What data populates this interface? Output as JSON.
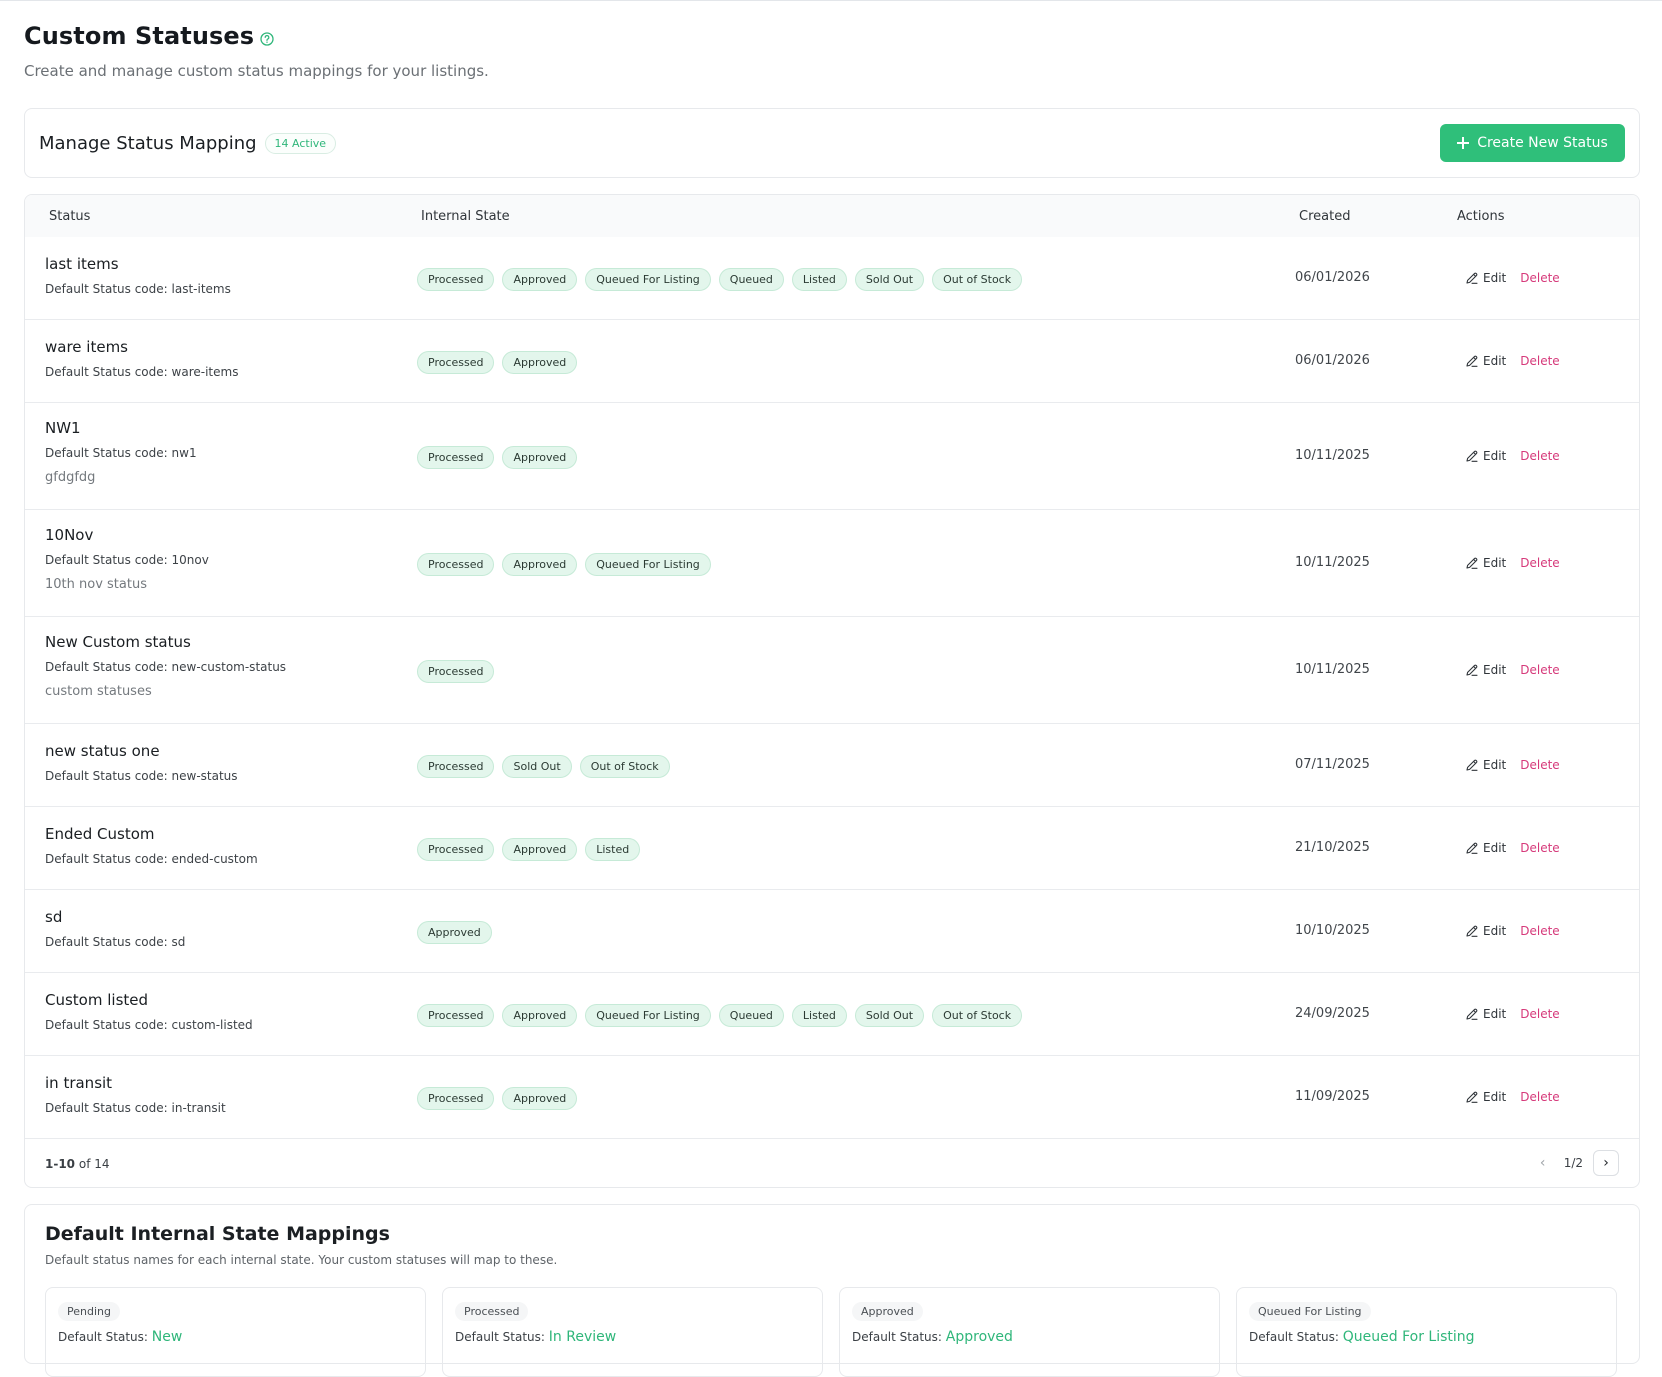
{
  "header": {
    "title": "Custom Statuses",
    "subtitle": "Create and manage custom status mappings for your listings."
  },
  "manage": {
    "title": "Manage Status Mapping",
    "active_badge": "14 Active",
    "create_button": "Create New Status"
  },
  "table": {
    "columns": [
      "Status",
      "Internal State",
      "Created",
      "Actions"
    ],
    "code_prefix": "Default Status code:",
    "edit_label": "Edit",
    "delete_label": "Delete",
    "rows": [
      {
        "name": "last items",
        "code": "last-items",
        "description": "",
        "states": [
          "Processed",
          "Approved",
          "Queued For Listing",
          "Queued",
          "Listed",
          "Sold Out",
          "Out of Stock"
        ],
        "created": "06/01/2026"
      },
      {
        "name": "ware items",
        "code": "ware-items",
        "description": "",
        "states": [
          "Processed",
          "Approved"
        ],
        "created": "06/01/2026"
      },
      {
        "name": "NW1",
        "code": "nw1",
        "description": "gfdgfdg",
        "states": [
          "Processed",
          "Approved"
        ],
        "created": "10/11/2025"
      },
      {
        "name": "10Nov",
        "code": "10nov",
        "description": "10th nov status",
        "states": [
          "Processed",
          "Approved",
          "Queued For Listing"
        ],
        "created": "10/11/2025"
      },
      {
        "name": "New Custom status",
        "code": "new-custom-status",
        "description": "custom statuses",
        "states": [
          "Processed"
        ],
        "created": "10/11/2025"
      },
      {
        "name": "new status one",
        "code": "new-status",
        "description": "",
        "states": [
          "Processed",
          "Sold Out",
          "Out of Stock"
        ],
        "created": "07/11/2025"
      },
      {
        "name": "Ended Custom",
        "code": "ended-custom",
        "description": "",
        "states": [
          "Processed",
          "Approved",
          "Listed"
        ],
        "created": "21/10/2025"
      },
      {
        "name": "sd",
        "code": "sd",
        "description": "",
        "states": [
          "Approved"
        ],
        "created": "10/10/2025"
      },
      {
        "name": "Custom listed",
        "code": "custom-listed",
        "description": "",
        "states": [
          "Processed",
          "Approved",
          "Queued For Listing",
          "Queued",
          "Listed",
          "Sold Out",
          "Out of Stock"
        ],
        "created": "24/09/2025"
      },
      {
        "name": "in transit",
        "code": "in-transit",
        "description": "",
        "states": [
          "Processed",
          "Approved"
        ],
        "created": "11/09/2025"
      }
    ]
  },
  "pagination": {
    "range": "1-10",
    "of_text": "of 14",
    "page": "1/2"
  },
  "defaults": {
    "title": "Default Internal State Mappings",
    "subtitle": "Default status names for each internal state. Your custom statuses will map to these.",
    "default_prefix": "Default Status:",
    "items": [
      {
        "state": "Pending",
        "value": "New"
      },
      {
        "state": "Processed",
        "value": "In Review"
      },
      {
        "state": "Approved",
        "value": "Approved"
      },
      {
        "state": "Queued For Listing",
        "value": "Queued For Listing"
      }
    ]
  },
  "colors": {
    "accent": "#2fbf7a",
    "delete": "#d6397a",
    "pill_bg": "#e3f6ec"
  }
}
